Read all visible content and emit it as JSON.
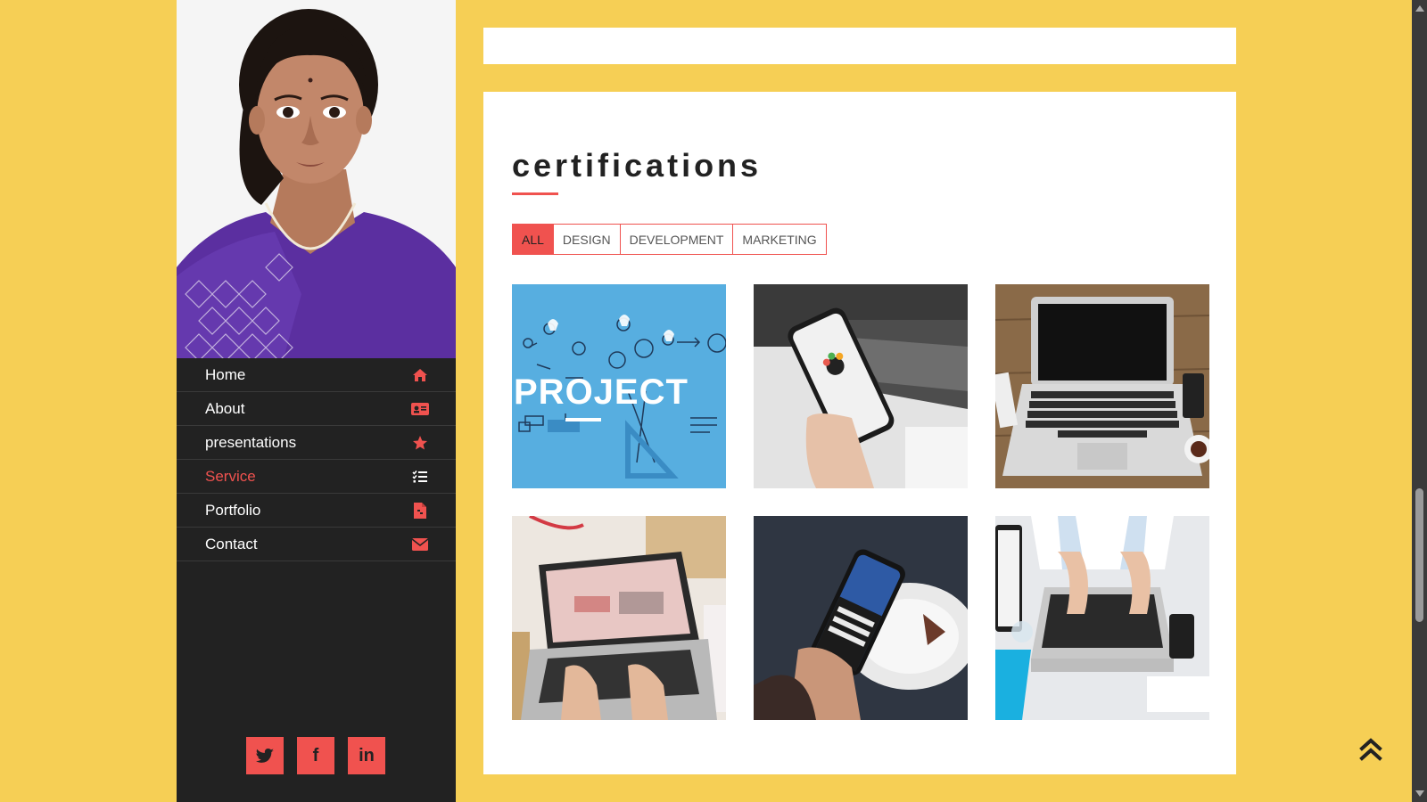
{
  "sidebar": {
    "nav": [
      {
        "label": "Home",
        "icon": "home-icon",
        "active": false
      },
      {
        "label": "About",
        "icon": "id-card-icon",
        "active": false
      },
      {
        "label": "presentations",
        "icon": "star-icon",
        "active": false
      },
      {
        "label": "Service",
        "icon": "list-check-icon",
        "active": true
      },
      {
        "label": "Portfolio",
        "icon": "file-icon",
        "active": false
      },
      {
        "label": "Contact",
        "icon": "envelope-icon",
        "active": false
      }
    ],
    "social": [
      {
        "name": "twitter",
        "glyph": "🐦"
      },
      {
        "name": "facebook",
        "glyph": "f"
      },
      {
        "name": "linkedin",
        "glyph": "in"
      }
    ]
  },
  "main": {
    "section_title": "certifications",
    "filters": [
      "ALL",
      "DESIGN",
      "DEVELOPMENT",
      "MARKETING"
    ],
    "active_filter": "ALL",
    "portfolio_items": [
      {
        "name": "project-illustration"
      },
      {
        "name": "phone-over-laptop"
      },
      {
        "name": "laptop-on-desk"
      },
      {
        "name": "hands-typing-laptop"
      },
      {
        "name": "phone-in-hand"
      },
      {
        "name": "laptop-overhead"
      }
    ]
  },
  "colors": {
    "background": "#f6cf55",
    "sidebar": "#222222",
    "accent": "#f0524f",
    "card": "#ffffff"
  }
}
